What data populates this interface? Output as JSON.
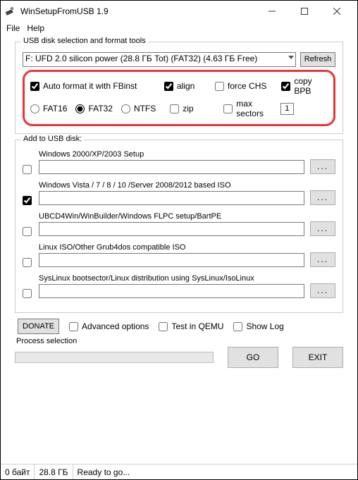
{
  "title": "WinSetupFromUSB 1.9",
  "menu": {
    "file": "File",
    "help": "Help"
  },
  "fieldset1_legend": "USB disk selection and format tools",
  "disk_selected": "F: UFD 2.0 silicon power (28.8 ГБ Tot) (FAT32) (4.63 ГБ Free)",
  "refresh_btn": "Refresh",
  "fmt": {
    "autoformat": "Auto format it with FBinst",
    "fat16": "FAT16",
    "fat32": "FAT32",
    "ntfs": "NTFS",
    "align": "align",
    "zip": "zip",
    "forcechs": "force CHS",
    "maxsectors": "max sectors",
    "copybpb": "copy BPB",
    "maxsectors_val": "1"
  },
  "add_legend": "Add to USB disk:",
  "rows": [
    "Windows 2000/XP/2003 Setup",
    "Windows Vista / 7 / 8 / 10 /Server 2008/2012 based ISO",
    "UBCD4Win/WinBuilder/Windows FLPC setup/BartPE",
    "Linux ISO/Other Grub4dos compatible ISO",
    "SysLinux bootsector/Linux distribution using SysLinux/IsoLinux"
  ],
  "browse": "...",
  "donate": "DONATE",
  "adv": "Advanced options",
  "qemu": "Test in QEMU",
  "showlog": "Show Log",
  "proc_label": "Process selection",
  "go": "GO",
  "exit": "EXIT",
  "status": {
    "c1": "0 байт",
    "c2": "28.8 ГБ",
    "c3": "Ready to go..."
  }
}
